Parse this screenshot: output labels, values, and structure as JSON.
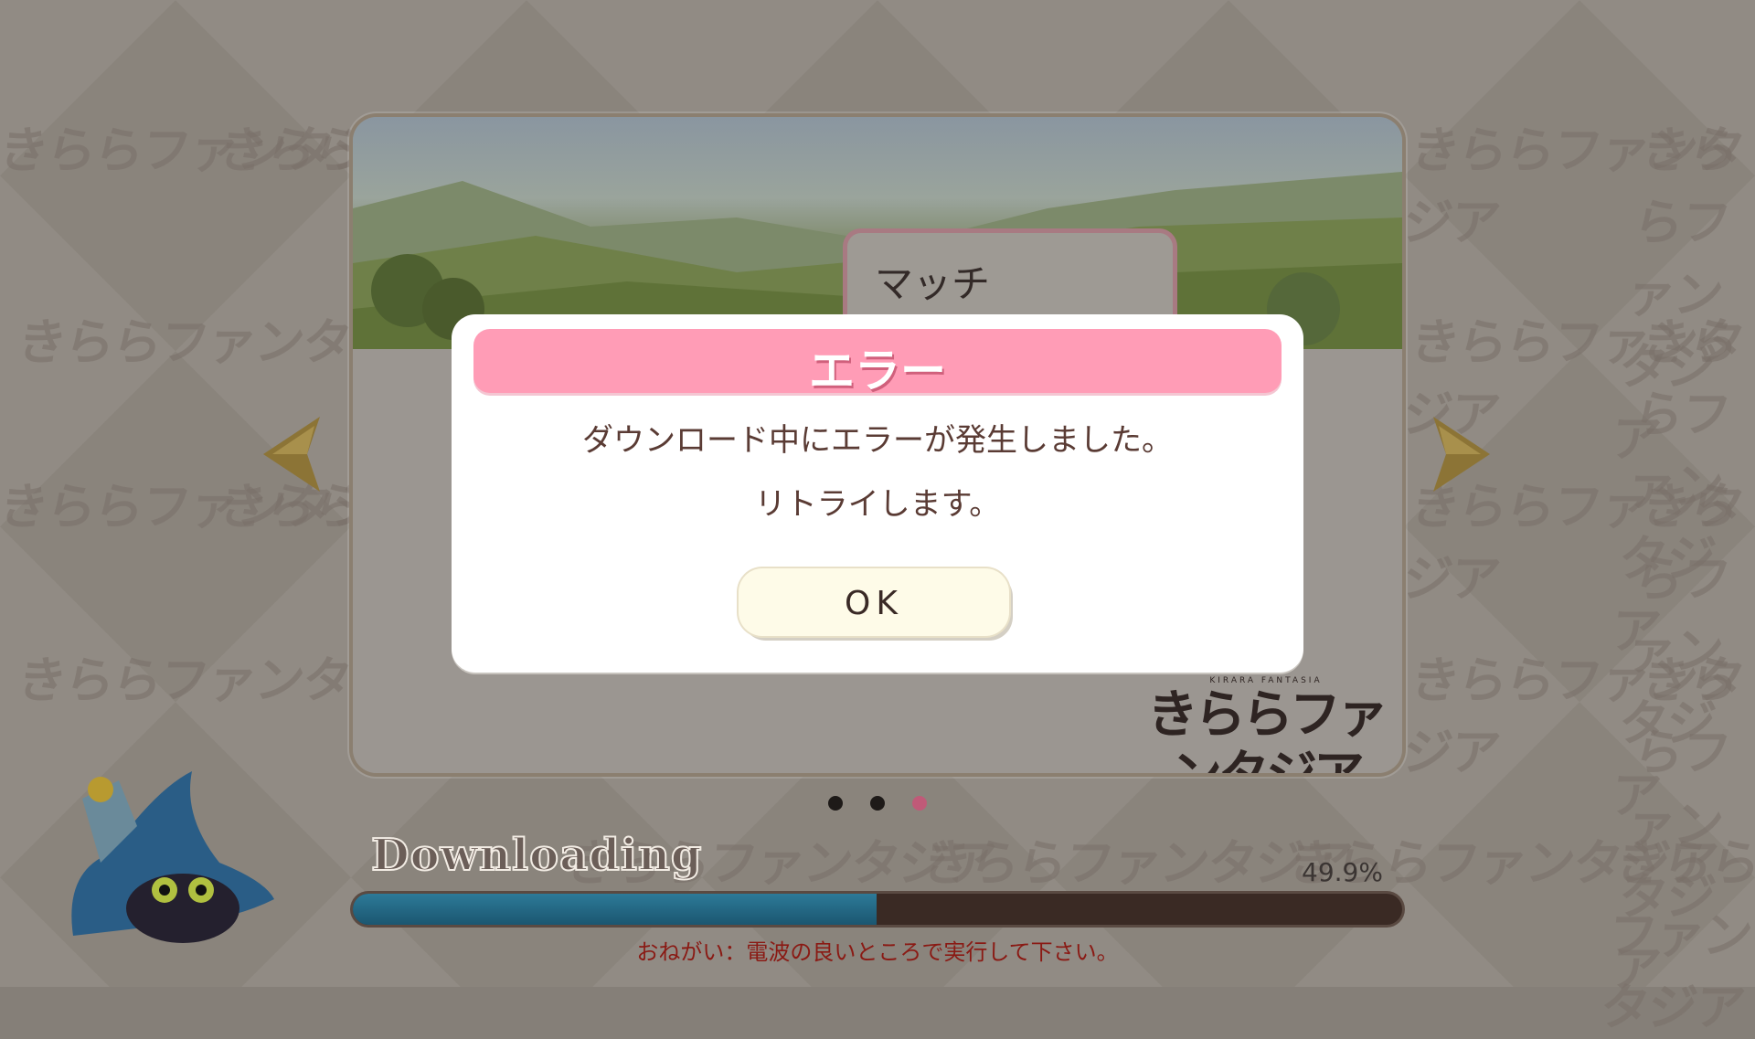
{
  "dialog": {
    "title": "エラー",
    "message_line1": "ダウンロード中にエラーが発生しました。",
    "message_line2": "リトライします。",
    "ok_label": "OK"
  },
  "banner": {
    "sign_text": "マッチ",
    "logo_text": "きららファンタジア",
    "logo_subtitle": "KIRARA FANTASIA"
  },
  "watermark_text": "きららファンタジア",
  "carousel": {
    "page_count": 3,
    "active_index": 2
  },
  "download": {
    "title": "Downloading",
    "percent_label": "49.9%",
    "progress": 0.499,
    "notice": "おねがい：電波の良いところで実行して下さい。"
  },
  "colors": {
    "header_pink": "#ff9cb6",
    "progress_blue": "#1e6a88",
    "progress_track": "#3a2a24",
    "notice_red": "#8a1a14",
    "dot_active": "#c05a78",
    "dot_inactive": "#1e1a18",
    "arrow_gold": "#8c7436"
  },
  "icons": {
    "left_arrow": "arrow-left-icon",
    "right_arrow": "arrow-right-icon",
    "mascot": "wizard-cat-mascot"
  }
}
